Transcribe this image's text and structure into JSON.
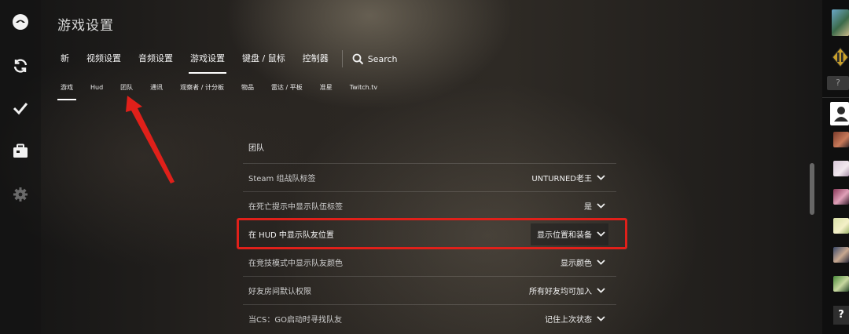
{
  "header": {
    "title": "游戏设置"
  },
  "main_tabs": [
    {
      "label": "新"
    },
    {
      "label": "视频设置"
    },
    {
      "label": "音频设置"
    },
    {
      "label": "游戏设置",
      "active": true
    },
    {
      "label": "键盘 / 鼠标"
    },
    {
      "label": "控制器"
    }
  ],
  "search": {
    "label": "Search",
    "icon": "search-icon"
  },
  "sub_tabs": [
    {
      "label": "游戏",
      "active": true
    },
    {
      "label": "Hud"
    },
    {
      "label": "团队"
    },
    {
      "label": "通讯"
    },
    {
      "label": "观察者 / 计分板"
    },
    {
      "label": "物品"
    },
    {
      "label": "雷达 / 平板"
    },
    {
      "label": "准星"
    },
    {
      "label": "Twitch.tv"
    }
  ],
  "section": {
    "title": "团队"
  },
  "settings": [
    {
      "label": "Steam 组战队标签",
      "value": "UNTURNED老王"
    },
    {
      "label": "在死亡提示中显示队伍标签",
      "value": "是"
    },
    {
      "label": "在 HUD 中显示队友位置",
      "value": "显示位置和装备",
      "highlighted": true
    },
    {
      "label": "在竞技模式中显示队友颜色",
      "value": "显示颜色"
    },
    {
      "label": "好友房间默认权限",
      "value": "所有好友均可加入"
    },
    {
      "label": "当CS：GO启动时寻找队友",
      "value": "记住上次状态"
    }
  ],
  "left_rail_icons": [
    "logo-icon",
    "refresh-icon",
    "check-icon",
    "inventory-icon",
    "gear-icon"
  ],
  "right_rail": {
    "help_glyph": "?",
    "help_glyph_bottom": "?"
  },
  "colors": {
    "highlight_border": "#e0201a",
    "annotation_arrow": "#e0201a"
  }
}
